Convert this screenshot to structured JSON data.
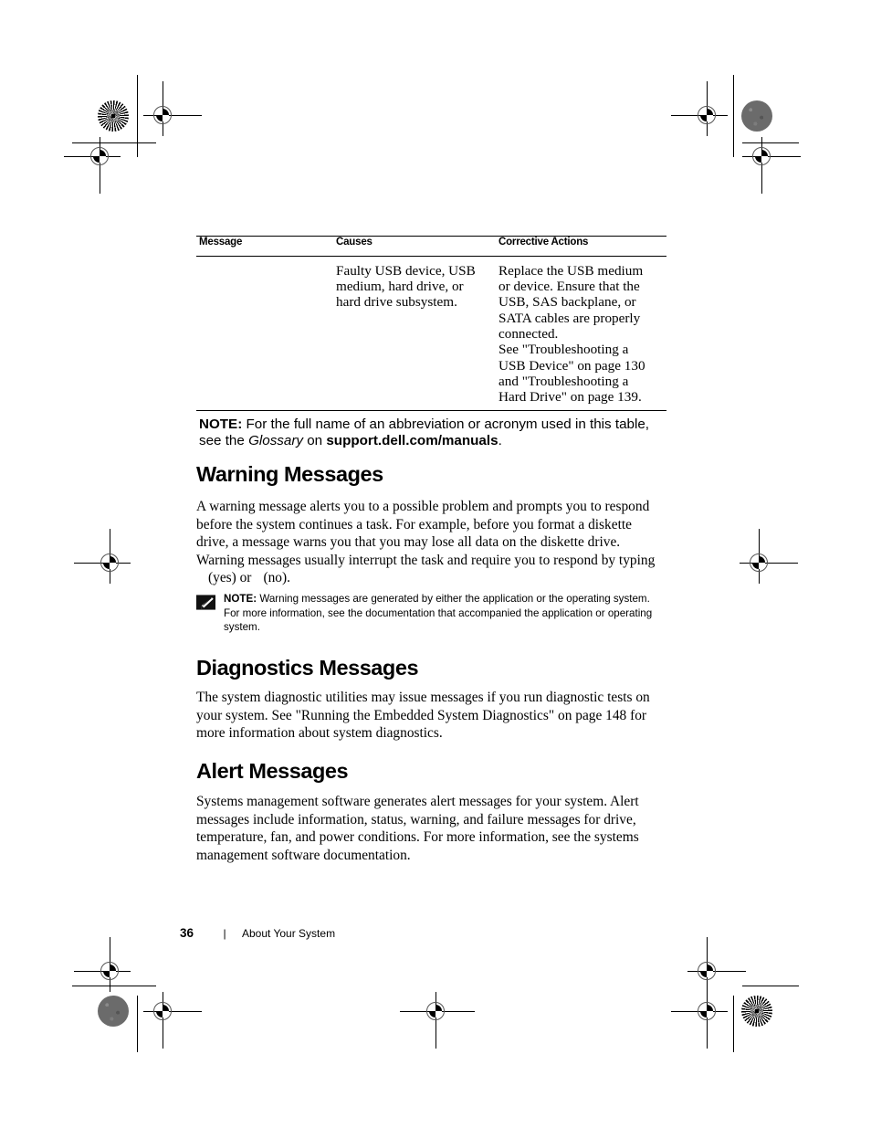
{
  "table": {
    "headers": [
      "Message",
      "Causes",
      "Corrective Actions"
    ],
    "rows": [
      {
        "message": "",
        "causes": "Faulty USB device, USB medium, hard drive, or hard drive subsystem.",
        "corrective": "Replace the USB medium or device. Ensure that the USB, SAS backplane, or SATA cables are properly connected.\nSee \"Troubleshooting a USB Device\" on page 130\nand \"Troubleshooting a Hard Drive\" on page 139."
      }
    ],
    "footnote": {
      "label": "NOTE:",
      "text_before": "For the full name of an abbreviation or acronym used in this table, see the",
      "italic_term": "Glossary",
      "text_middle": "on",
      "bold_term": "support.dell.com/manuals",
      "text_after": "."
    }
  },
  "sections": [
    {
      "heading": "Warning Messages",
      "paragraph_part1": "A warning message alerts you to a possible problem and prompts you to respond before the system continues a task. For example, before you format a diskette drive, a message warns you that you may lose all data on the diskette drive. Warning messages usually interrupt the task and require you to respond by typing",
      "paragraph_yes": "(yes) or",
      "paragraph_no": "(no)."
    },
    {
      "heading": "Diagnostics Messages",
      "paragraph": "The system diagnostic utilities may issue messages if you run diagnostic tests on your system. See \"Running the Embedded System Diagnostics\" on page 148 for more information about system diagnostics."
    },
    {
      "heading": "Alert Messages",
      "paragraph": "Systems management software generates alert messages for your system. Alert messages include information, status, warning, and failure messages for drive, temperature, fan, and power conditions. For more information, see the systems management software documentation."
    }
  ],
  "note_box": {
    "label": "NOTE:",
    "text": "Warning messages are generated by either the application or the operating system. For more information, see the documentation that accompanied the application or operating system.",
    "icon": "pencil-note-icon"
  },
  "footer": {
    "page_number": "36",
    "separator": "|",
    "chapter": "About Your System"
  }
}
